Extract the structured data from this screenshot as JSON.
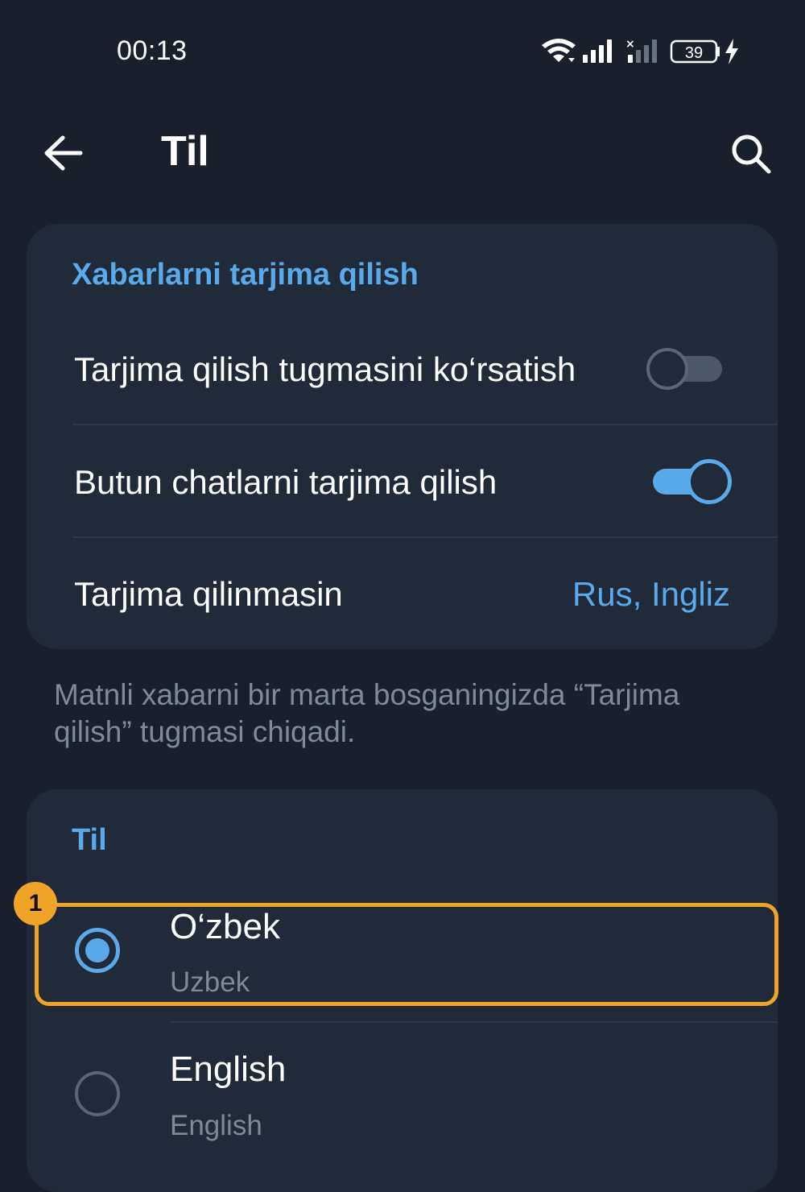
{
  "status_bar": {
    "time": "00:13",
    "battery": "39",
    "icons": [
      "wifi-icon",
      "signal-icon",
      "signal-no-service-icon",
      "battery-icon",
      "charging-icon"
    ]
  },
  "app_bar": {
    "title": "Til",
    "back_icon": "arrow-left-icon",
    "search_icon": "search-icon"
  },
  "translate_section": {
    "title": "Xabarlarni tarjima qilish",
    "rows": [
      {
        "label": "Tarjima qilish tugmasini ko‘rsatish",
        "toggle": false
      },
      {
        "label": "Butun chatlarni tarjima qilish",
        "toggle": true
      },
      {
        "label": "Tarjima qilinmasin",
        "value": "Rus, Ingliz"
      }
    ],
    "footnote": "Matnli xabarni bir marta bosganingizda “Tarjima qilish” tugmasi chiqadi."
  },
  "language_section": {
    "title": "Til",
    "items": [
      {
        "name": "O‘zbek",
        "subtitle": "Uzbek",
        "selected": true
      },
      {
        "name": "English",
        "subtitle": "English",
        "selected": false
      }
    ]
  },
  "annotation": {
    "badge_number": "1"
  },
  "colors": {
    "background": "#19202b",
    "card": "#202a39",
    "accent": "#5aa9ea",
    "highlight": "#f0a427",
    "secondary_text": "#7f8a97"
  }
}
